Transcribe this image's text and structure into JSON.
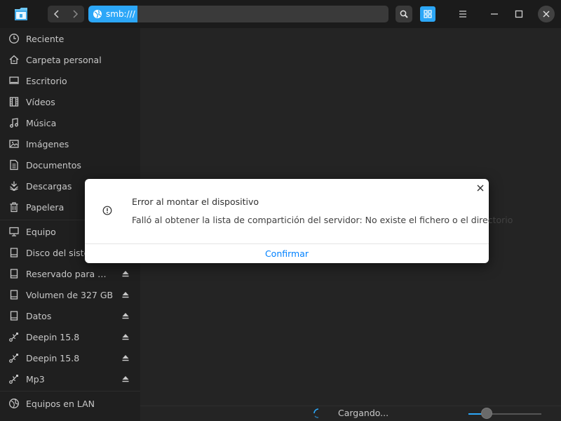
{
  "titlebar": {
    "address": "smb:///",
    "icons": {
      "logo": "file-manager-logo",
      "back": "chevron-left-icon",
      "forward": "chevron-right-icon",
      "network": "globe-icon",
      "search": "search-icon",
      "view": "grid-view-icon",
      "menu": "hamburger-menu-icon",
      "minimize": "minimize-icon",
      "maximize": "maximize-icon",
      "close": "close-icon"
    }
  },
  "sidebar": {
    "items": [
      {
        "label": "Reciente",
        "icon": "clock-icon"
      },
      {
        "label": "Carpeta personal",
        "icon": "home-icon"
      },
      {
        "label": "Escritorio",
        "icon": "desktop-icon"
      },
      {
        "label": "Vídeos",
        "icon": "film-icon"
      },
      {
        "label": "Música",
        "icon": "music-icon"
      },
      {
        "label": "Imágenes",
        "icon": "image-icon"
      },
      {
        "label": "Documentos",
        "icon": "document-icon"
      },
      {
        "label": "Descargas",
        "icon": "download-icon"
      },
      {
        "label": "Papelera",
        "icon": "trash-icon"
      }
    ],
    "devices": [
      {
        "label": "Equipo",
        "icon": "computer-icon"
      },
      {
        "label": "Disco del sistema",
        "icon": "disk-icon"
      },
      {
        "label": "Reservado para el sistema",
        "icon": "disk-icon",
        "eject": true
      },
      {
        "label": "Volumen de 327 GB",
        "icon": "disk-icon",
        "eject": true
      },
      {
        "label": "Datos",
        "icon": "disk-icon",
        "eject": true
      },
      {
        "label": "Deepin 15.8",
        "icon": "usb-icon",
        "eject": true
      },
      {
        "label": "Deepin 15.8",
        "icon": "usb-icon",
        "eject": true
      },
      {
        "label": "Mp3",
        "icon": "usb-icon",
        "eject": true
      }
    ],
    "network": [
      {
        "label": "Equipos en LAN",
        "icon": "network-icon"
      }
    ]
  },
  "status": {
    "text": "Cargando...",
    "zoom_level": 0.25
  },
  "dialog": {
    "title": "Error al montar el dispositivo",
    "message": "Falló al obtener la lista de compartición del servidor: No existe el fichero o el directorio",
    "confirm_label": "Confirmar",
    "icon": "warning-icon"
  },
  "colors": {
    "accent": "#2ca7f8",
    "link": "#0081ff"
  }
}
